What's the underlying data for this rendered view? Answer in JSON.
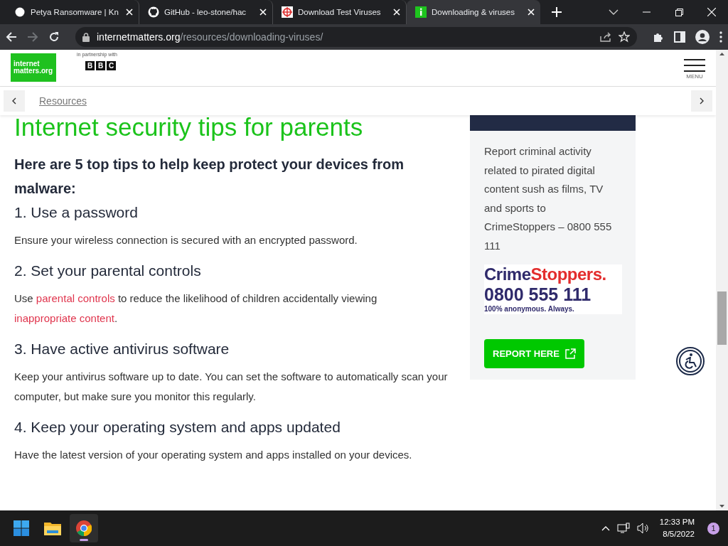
{
  "tabs": [
    {
      "title": "Petya Ransomware | Kn",
      "selected": false
    },
    {
      "title": "GitHub - leo-stone/hac",
      "selected": false
    },
    {
      "title": "Download Test Viruses",
      "selected": false
    },
    {
      "title": "Downloading & viruses",
      "selected": true
    }
  ],
  "address": {
    "domain": "internetmatters.org",
    "path": "/resources/downloading-viruses/",
    "forward_disabled": true
  },
  "site_header": {
    "logo_lines": [
      "internet",
      "matters.org"
    ],
    "partner_label": "in partnership with",
    "partner": [
      "B",
      "B",
      "C"
    ],
    "menu_label": "MENU"
  },
  "breadcrumb": {
    "label": "Resources"
  },
  "article": {
    "title": "Internet security tips for parents",
    "intro": "Here are 5 top tips to help keep protect your devices from malware:",
    "sections": [
      {
        "heading": "1. Use a password",
        "body": [
          {
            "text": "Ensure your wireless connection is secured with an encrypted password.",
            "link": false
          }
        ]
      },
      {
        "heading": "2. Set your parental controls",
        "body": [
          {
            "text": "Use ",
            "link": false
          },
          {
            "text": "parental controls",
            "link": true
          },
          {
            "text": " to reduce the likelihood of children accidentally viewing ",
            "link": false
          },
          {
            "text": "inappropriate content",
            "link": true
          },
          {
            "text": ".",
            "link": false
          }
        ]
      },
      {
        "heading": "3. Have active antivirus software",
        "body": [
          {
            "text": "Keep your antivirus software up to date. You can set the software to automatically scan your computer, but make sure you monitor this regularly.",
            "link": false
          }
        ]
      },
      {
        "heading": "4. Keep your operating system and apps updated",
        "body": [
          {
            "text": "Have the latest version of your operating system and apps installed on your devices.",
            "link": false
          }
        ]
      }
    ]
  },
  "sidebar": {
    "text": "Report criminal activity related to pirated digital content sush as films, TV and sports to CrimeStoppers – 0800 555 111",
    "logo": {
      "name_part1": "Crime",
      "name_part2": "Stoppers.",
      "number": "0800 555 111",
      "tagline": "100% anonymous. Always."
    },
    "button": "REPORT HERE"
  },
  "taskbar": {
    "apps": [
      {
        "kind": "start",
        "active": false
      },
      {
        "kind": "folder",
        "active": false
      },
      {
        "kind": "browser",
        "active": true
      }
    ],
    "time": "12:33 PM",
    "date": "8/5/2022",
    "notifications": "1"
  }
}
